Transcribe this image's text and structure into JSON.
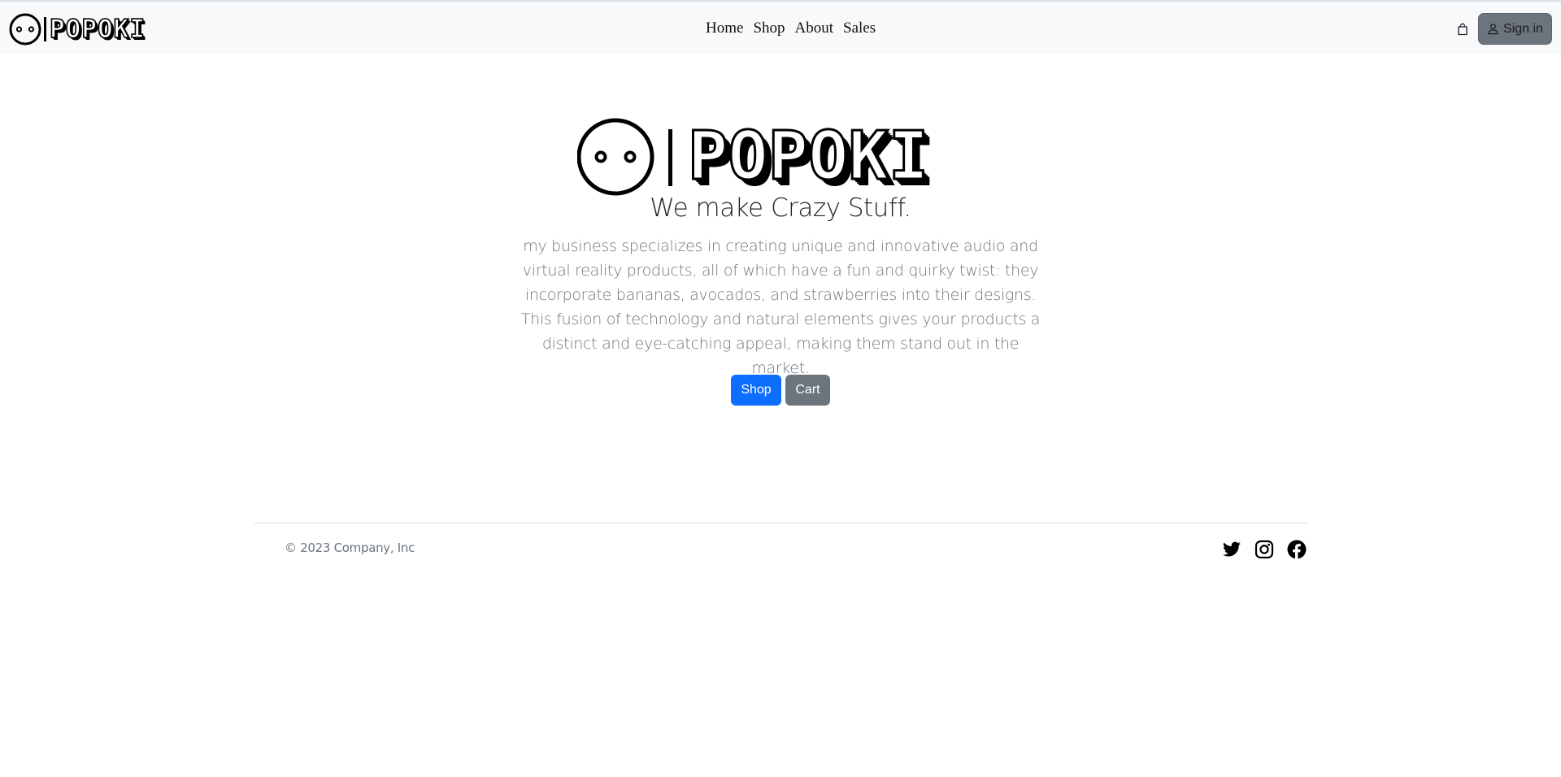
{
  "brand": {
    "name": "POPOKI",
    "logo_icon": "popoki-face-icon"
  },
  "nav": {
    "items": [
      {
        "label": "Home"
      },
      {
        "label": "Shop"
      },
      {
        "label": "About"
      },
      {
        "label": "Sales"
      }
    ],
    "cart_icon": "shopping-bag-icon",
    "signin": {
      "label": "Sign in",
      "icon": "person-icon"
    }
  },
  "hero": {
    "wordmark": "POPOKI",
    "headline": "We make Crazy Stuff.",
    "description": "my business specializes in creating unique and innovative audio and virtual reality products, all of which have a fun and quirky twist: they incorporate bananas, avocados, and strawberries into their designs. This fusion of technology and natural elements gives your products a distinct and eye-catching appeal, making them stand out in the market.",
    "buttons": {
      "shop": "Shop",
      "cart": "Cart"
    }
  },
  "footer": {
    "copyright": "© 2023 Company, Inc",
    "social": [
      "twitter-icon",
      "instagram-icon",
      "facebook-icon"
    ]
  },
  "colors": {
    "primary": "#0d6efd",
    "secondary": "#6c757d",
    "navbar_bg": "#f8f9fa",
    "text_muted": "#6c757d"
  }
}
